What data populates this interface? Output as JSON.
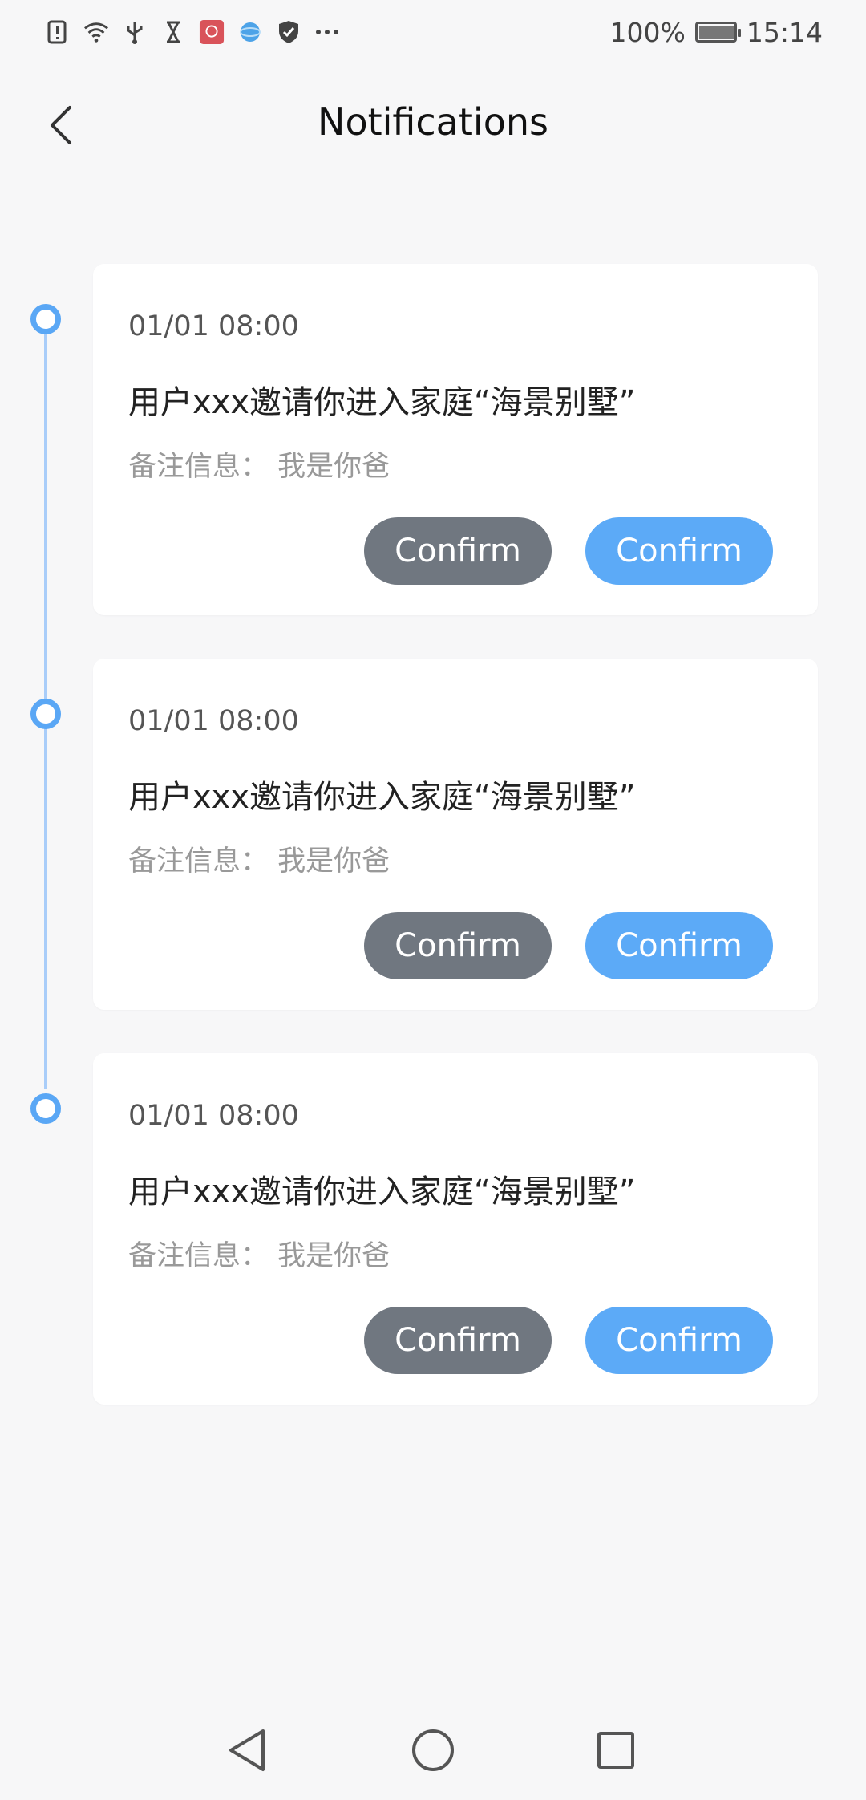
{
  "status_bar": {
    "icons": [
      "alert-icon",
      "wifi-icon",
      "usb-icon",
      "hourglass-icon",
      "huawei-app-icon",
      "browser-icon",
      "shield-icon",
      "more-dots-icon"
    ],
    "battery_percent": "100%",
    "time": "15:14"
  },
  "header": {
    "title": "Notifications",
    "back_icon": "chevron-left-icon"
  },
  "notifications": [
    {
      "time": "01/01 08:00",
      "message": "用户xxx邀请你进入家庭“海景别墅”",
      "remark": "备注信息： 我是你爸",
      "button_secondary": "Confirm",
      "button_primary": "Confirm"
    },
    {
      "time": "01/01 08:00",
      "message": "用户xxx邀请你进入家庭“海景别墅”",
      "remark": "备注信息： 我是你爸",
      "button_secondary": "Confirm",
      "button_primary": "Confirm"
    },
    {
      "time": "01/01 08:00",
      "message": "用户xxx邀请你进入家庭“海景别墅”",
      "remark": "备注信息： 我是你爸",
      "button_secondary": "Confirm",
      "button_primary": "Confirm"
    }
  ],
  "colors": {
    "accent": "#5caaf7",
    "secondary_button": "#707780",
    "timeline": "#a9cdf9",
    "background": "#f7f7f8"
  },
  "nav_bar": {
    "icons": [
      "back-triangle-icon",
      "home-circle-icon",
      "recents-square-icon"
    ]
  }
}
